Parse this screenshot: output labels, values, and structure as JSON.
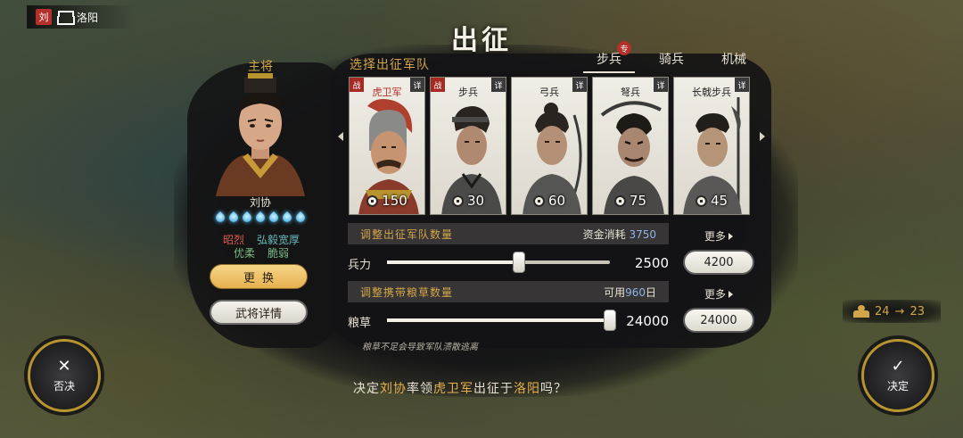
{
  "location": {
    "faction": "刘",
    "city": "洛阳"
  },
  "dialog": {
    "title": "出征",
    "general": {
      "label": "主将",
      "name": "刘协",
      "traits_row1": [
        "昭烈",
        "弘毅宽厚"
      ],
      "traits_row2": [
        "优柔",
        "脆弱"
      ],
      "change_label": "更换",
      "details_label": "武将详情"
    },
    "troops": {
      "label": "选择出征军队",
      "tabs": [
        {
          "label": "步兵",
          "active": true
        },
        {
          "label": "骑兵",
          "active": false
        },
        {
          "label": "机械",
          "active": false
        }
      ],
      "tab_badge": "专",
      "cards": [
        {
          "name": "虎卫军",
          "cost": "150",
          "battle_tag": "战",
          "detail_tag": "详",
          "special": true
        },
        {
          "name": "步兵",
          "cost": "30",
          "battle_tag": "战",
          "detail_tag": "详",
          "special": false
        },
        {
          "name": "弓兵",
          "cost": "60",
          "battle_tag": "",
          "detail_tag": "详",
          "special": false
        },
        {
          "name": "弩兵",
          "cost": "75",
          "battle_tag": "",
          "detail_tag": "详",
          "special": false
        },
        {
          "name": "长戟步兵",
          "cost": "45",
          "battle_tag": "",
          "detail_tag": "详",
          "special": false
        }
      ]
    },
    "army": {
      "title": "调整出征军队数量",
      "cost_label": "资金消耗",
      "cost_value": "3750",
      "slider_label": "兵力",
      "value": "2500",
      "value_fraction": 0.59,
      "more": "更多",
      "max": "4200"
    },
    "supplies": {
      "title": "调整携带粮草数量",
      "available_label": "可用",
      "available_value": "960",
      "available_unit": "日",
      "slider_label": "粮草",
      "value": "24000",
      "value_fraction": 1.0,
      "more": "更多",
      "max": "24000",
      "warning": "粮草不足会导致军队溃散逃离"
    },
    "confirm": {
      "prefix": "决定",
      "general": "刘协",
      "verb": "率领",
      "unit": "虎卫军",
      "mid": "出征于",
      "target": "洛阳",
      "suffix": "吗？"
    }
  },
  "buttons": {
    "cancel_label": "否决",
    "confirm_label": "决定"
  },
  "supply_indicator": {
    "from": "24",
    "arrow": "→",
    "to": "23"
  }
}
